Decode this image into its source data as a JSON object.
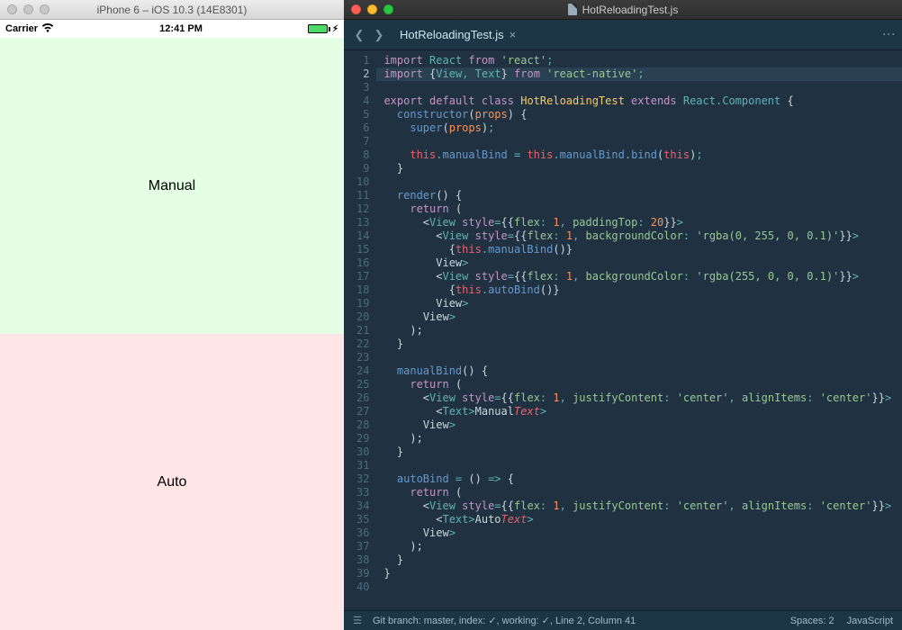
{
  "simulator": {
    "window_title": "iPhone 6 – iOS 10.3 (14E8301)",
    "statusbar": {
      "carrier": "Carrier",
      "time": "12:41 PM"
    },
    "app": {
      "top_label": "Manual",
      "bottom_label": "Auto"
    }
  },
  "editor": {
    "window_title": "HotReloadingTest.js",
    "tab": {
      "label": "HotReloadingTest.js"
    },
    "status": {
      "left": "Git branch: master, index: ✓, working: ✓, Line 2, Column 41",
      "spaces": "Spaces: 2",
      "lang": "JavaScript"
    },
    "lines": [
      "1",
      "2",
      "3",
      "4",
      "5",
      "6",
      "7",
      "8",
      "9",
      "10",
      "11",
      "12",
      "13",
      "14",
      "15",
      "16",
      "17",
      "18",
      "19",
      "20",
      "21",
      "22",
      "23",
      "24",
      "25",
      "26",
      "27",
      "28",
      "29",
      "30",
      "31",
      "32",
      "33",
      "34",
      "35",
      "36",
      "37",
      "38",
      "39",
      "40"
    ],
    "code_tokens": {
      "l1": [
        "import",
        " ",
        "React",
        " ",
        "from",
        " ",
        "'react'",
        ";"
      ],
      "l2": [
        "import",
        " ",
        "{",
        "View",
        ",",
        " ",
        "Text",
        "}",
        " ",
        "from",
        " ",
        "'react-native'",
        ";"
      ],
      "l4": [
        "export",
        " ",
        "default",
        " ",
        "class",
        " ",
        "HotReloadingTest",
        " ",
        "extends",
        " ",
        "React",
        ".",
        "Component",
        " ",
        "{"
      ],
      "l5": [
        "  ",
        "constructor",
        "(",
        "props",
        ")",
        " ",
        "{"
      ],
      "l6": [
        "    ",
        "super",
        "(",
        "props",
        ")",
        ";"
      ],
      "l8": [
        "    ",
        "this",
        ".",
        "manualBind",
        " = ",
        "this",
        ".",
        "manualBind",
        ".",
        "bind",
        "(",
        "this",
        ")",
        ";"
      ],
      "l9": [
        "  }"
      ],
      "l11": [
        "  ",
        "render",
        "()",
        " {"
      ],
      "l12": [
        "    ",
        "return",
        " ("
      ],
      "l13": [
        "      <",
        "View",
        " ",
        "style",
        "=",
        "{",
        "{",
        "flex",
        ":",
        " ",
        "1",
        ",",
        " ",
        "paddingTop",
        ":",
        " ",
        "20",
        "}",
        "}",
        ">"
      ],
      "l14": [
        "        <",
        "View",
        " ",
        "style",
        "=",
        "{",
        "{",
        "flex",
        ":",
        " ",
        "1",
        ",",
        " ",
        "backgroundColor",
        ":",
        " ",
        "'rgba(0, 255, 0, 0.1)'",
        "}",
        "}",
        ">"
      ],
      "l15": [
        "          {",
        "this",
        ".",
        "manualBind",
        "(",
        ")",
        "}"
      ],
      "l16": [
        "        </",
        "View",
        ">"
      ],
      "l17": [
        "        <",
        "View",
        " ",
        "style",
        "=",
        "{",
        "{",
        "flex",
        ":",
        " ",
        "1",
        ",",
        " ",
        "backgroundColor",
        ":",
        " ",
        "'rgba(255, 0, 0, 0.1)'",
        "}",
        "}",
        ">"
      ],
      "l18": [
        "          {",
        "this",
        ".",
        "autoBind",
        "(",
        ")",
        "}"
      ],
      "l19": [
        "        </",
        "View",
        ">"
      ],
      "l20": [
        "      </",
        "View",
        ">"
      ],
      "l21": [
        "    );"
      ],
      "l22": [
        "  }"
      ],
      "l24": [
        "  ",
        "manualBind",
        "()",
        " {"
      ],
      "l25": [
        "    ",
        "return",
        " ("
      ],
      "l26": [
        "      <",
        "View",
        " ",
        "style",
        "=",
        "{",
        "{",
        "flex",
        ":",
        " ",
        "1",
        ",",
        " ",
        "justifyContent",
        ":",
        " ",
        "'center'",
        ",",
        " ",
        "alignItems",
        ":",
        " ",
        "'center'",
        "}",
        "}",
        ">"
      ],
      "l27": [
        "        <",
        "Text",
        ">",
        "Manual",
        "</",
        "Text",
        ">"
      ],
      "l28": [
        "      </",
        "View",
        ">"
      ],
      "l29": [
        "    );"
      ],
      "l30": [
        "  }"
      ],
      "l32": [
        "  ",
        "autoBind",
        " = ",
        "()",
        " => ",
        "{"
      ],
      "l33": [
        "    ",
        "return",
        " ("
      ],
      "l34": [
        "      <",
        "View",
        " ",
        "style",
        "=",
        "{",
        "{",
        "flex",
        ":",
        " ",
        "1",
        ",",
        " ",
        "justifyContent",
        ":",
        " ",
        "'center'",
        ",",
        " ",
        "alignItems",
        ":",
        " ",
        "'center'",
        "}",
        "}",
        ">"
      ],
      "l35": [
        "        <",
        "Text",
        ">",
        "Auto",
        "</",
        "Text",
        ">"
      ],
      "l36": [
        "      </",
        "View",
        ">"
      ],
      "l37": [
        "    );"
      ],
      "l38": [
        "  }"
      ],
      "l39": [
        "}"
      ]
    }
  }
}
